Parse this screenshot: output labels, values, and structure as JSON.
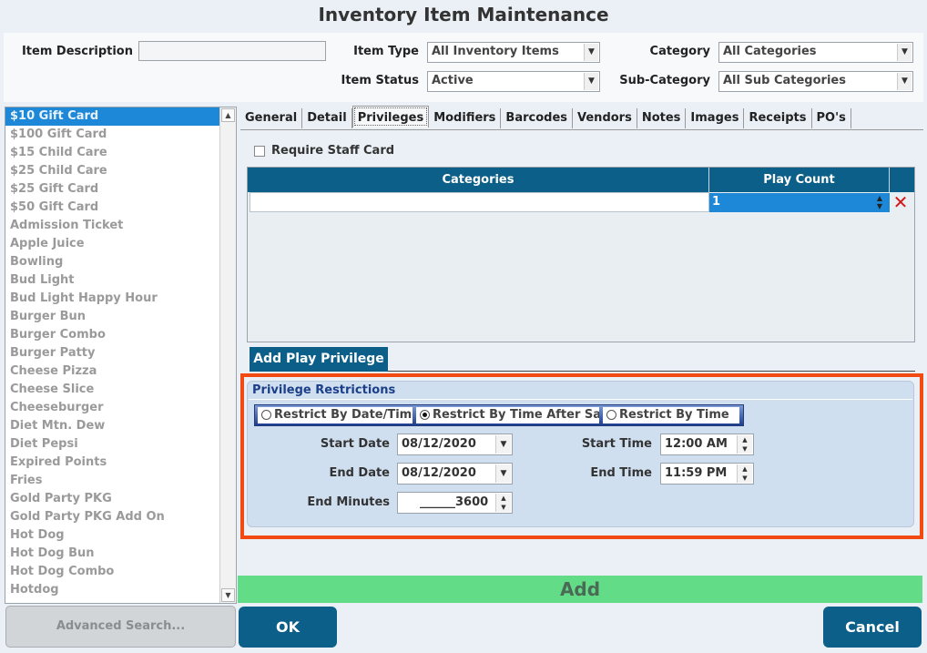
{
  "window": {
    "title": "Inventory Item Maintenance"
  },
  "filters": {
    "item_description_label": "Item Description",
    "item_description_value": "",
    "item_type_label": "Item Type",
    "item_type_value": "All Inventory Items",
    "category_label": "Category",
    "category_value": "All Categories",
    "item_status_label": "Item Status",
    "item_status_value": "Active",
    "sub_category_label": "Sub-Category",
    "sub_category_value": "All Sub Categories"
  },
  "item_list": {
    "items": [
      "$10 Gift Card",
      "$100 Gift Card",
      "$15 Child Care",
      "$25 Child Care",
      "$25 Gift Card",
      "$50 Gift Card",
      "Admission Ticket",
      "Apple Juice",
      "Bowling",
      "Bud Light",
      "Bud Light Happy Hour",
      "Burger Bun",
      "Burger Combo",
      "Burger Patty",
      "Cheese Pizza",
      "Cheese Slice",
      "Cheeseburger",
      "Diet Mtn. Dew",
      "Diet Pepsi",
      "Expired Points",
      "Fries",
      "Gold Party PKG",
      "Gold Party PKG Add On",
      "Hot Dog",
      "Hot Dog Bun",
      "Hot Dog Combo",
      "Hotdog"
    ],
    "selected_index": 0
  },
  "advanced_search_label": "Advanced Search...",
  "tabs": [
    {
      "label": "General"
    },
    {
      "label": "Detail"
    },
    {
      "label": "Privileges"
    },
    {
      "label": "Modifiers"
    },
    {
      "label": "Barcodes"
    },
    {
      "label": "Vendors"
    },
    {
      "label": "Notes"
    },
    {
      "label": "Images"
    },
    {
      "label": "Receipts"
    },
    {
      "label": "PO's"
    }
  ],
  "active_tab": "Privileges",
  "privileges": {
    "require_staff_card_label": "Require Staff Card",
    "require_staff_card_checked": false,
    "grid": {
      "columns": [
        "Categories",
        "Play Count"
      ],
      "rows": [
        {
          "category": "",
          "play_count": "1"
        }
      ]
    },
    "add_play_privilege_label": "Add Play Privilege"
  },
  "restrictions": {
    "title": "Privilege Restrictions",
    "options": [
      {
        "label": "Restrict By Date/Time",
        "selected": false
      },
      {
        "label": "Restrict By Time After Sale",
        "selected": true
      },
      {
        "label": "Restrict By Time",
        "selected": false
      }
    ],
    "start_date_label": "Start Date",
    "start_date_value": "08/12/2020",
    "end_date_label": "End Date",
    "end_date_value": "08/12/2020",
    "start_time_label": "Start Time",
    "start_time_value": "12:00 AM",
    "end_time_label": "End Time",
    "end_time_value": "11:59 PM",
    "end_minutes_label": "End Minutes",
    "end_minutes_value": "______3600"
  },
  "buttons": {
    "add": "Add",
    "ok": "OK",
    "cancel": "Cancel"
  },
  "icons": {
    "dropdown": "chevron-down-icon",
    "spinner": "spinner-icon",
    "delete": "delete-x-icon",
    "checkbox": "checkbox-icon"
  },
  "colors": {
    "header_blue": "#0b5f88",
    "selection_blue": "#1d87d8",
    "highlight_frame": "#f14a12",
    "add_bar_green": "#63dc88",
    "delete_red": "#d01a1a"
  }
}
